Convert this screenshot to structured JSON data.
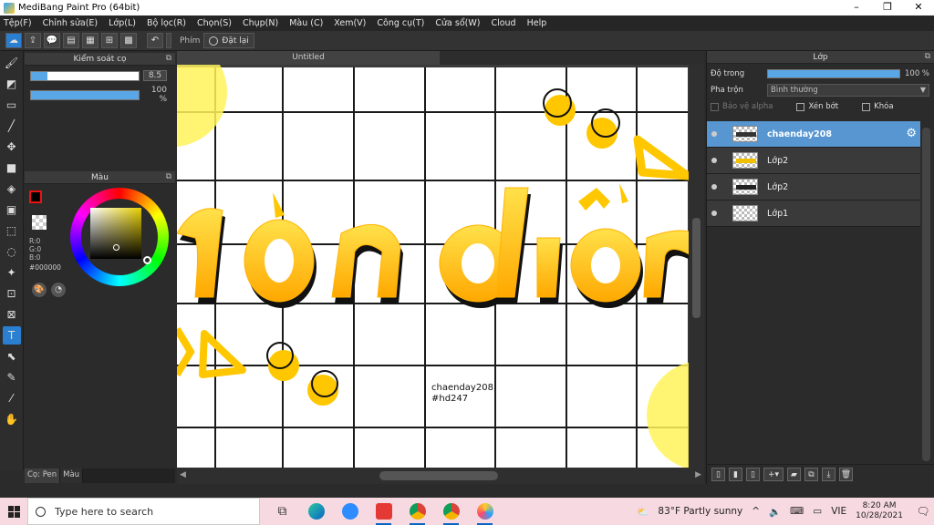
{
  "window": {
    "title": "MediBang Paint Pro (64bit)",
    "controls": [
      "–",
      "❐",
      "✕"
    ]
  },
  "menu": [
    "Tệp(F)",
    "Chỉnh sửa(E)",
    "Lớp(L)",
    "Bộ lọc(R)",
    "Chọn(S)",
    "Chụp(N)",
    "Màu (C)",
    "Xem(V)",
    "Công cụ(T)",
    "Cửa sổ(W)",
    "Cloud",
    "Help"
  ],
  "toolbar": {
    "shortcut_label": "Phím",
    "reset_label": "Đặt lại"
  },
  "brush_panel": {
    "title": "Kiểm soát cọ",
    "size_value": "8.5",
    "size_fraction": 0.15,
    "opacity_value": "100 %",
    "opacity_fraction": 1.0
  },
  "color_panel": {
    "title": "Màu",
    "rgb": [
      "R:0",
      "G:0",
      "B:0"
    ],
    "hex": "#000000",
    "fg_color": "#000000",
    "bg_color": "#ffffff"
  },
  "bottom_tabs": [
    "Cọ: Pen",
    "Màu"
  ],
  "document": {
    "tab_title": "Untitled",
    "text_lines": [
      "chaenday208",
      "#hd247"
    ],
    "yellow": "#ffc700",
    "grid_color": "#1a1a1a"
  },
  "layer_panel": {
    "title": "Lớp",
    "opacity_label": "Độ trong",
    "opacity_value": "100 %",
    "opacity_fraction": 1.0,
    "blend_label": "Pha trộn",
    "blend_value": "Bình thường",
    "checks": [
      {
        "label": "Bảo vệ alpha",
        "disabled": true
      },
      {
        "label": "Xén bớt",
        "disabled": false
      },
      {
        "label": "Khóa",
        "disabled": false
      }
    ],
    "layers": [
      {
        "name": "chaenday208",
        "selected": true
      },
      {
        "name": "Lớp2",
        "selected": false
      },
      {
        "name": "Lớp2",
        "selected": false
      },
      {
        "name": "Lớp1",
        "selected": false
      }
    ]
  },
  "taskbar": {
    "search_placeholder": "Type here to search",
    "weather": "83°F  Partly sunny",
    "language": "VIE",
    "time": "8:20 AM",
    "date": "10/28/2021"
  }
}
